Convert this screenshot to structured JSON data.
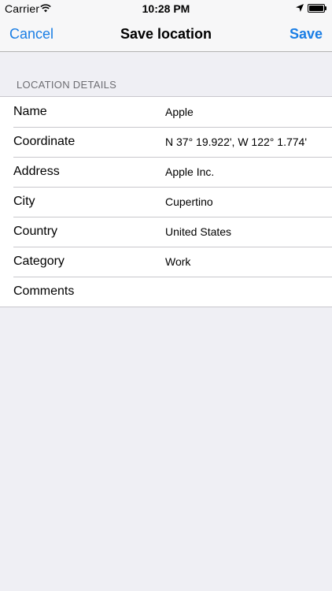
{
  "status_bar": {
    "carrier": "Carrier",
    "time": "10:28 PM",
    "icons": [
      "wifi-icon",
      "location-arrow-icon",
      "battery-icon"
    ]
  },
  "nav": {
    "cancel_label": "Cancel",
    "title": "Save location",
    "save_label": "Save"
  },
  "section": {
    "header": "LOCATION DETAILS"
  },
  "rows": [
    {
      "label": "Name",
      "value": "Apple"
    },
    {
      "label": "Coordinate",
      "value": "N 37° 19.922', W 122° 1.774'"
    },
    {
      "label": "Address",
      "value": "Apple Inc."
    },
    {
      "label": "City",
      "value": "Cupertino"
    },
    {
      "label": "Country",
      "value": "United States"
    },
    {
      "label": "Category",
      "value": "Work"
    },
    {
      "label": "Comments",
      "value": ""
    }
  ],
  "colors": {
    "accent": "#1a7ee5",
    "background": "#efeff4",
    "section_header": "#6d6d72",
    "separator": "#c8c7cc"
  }
}
